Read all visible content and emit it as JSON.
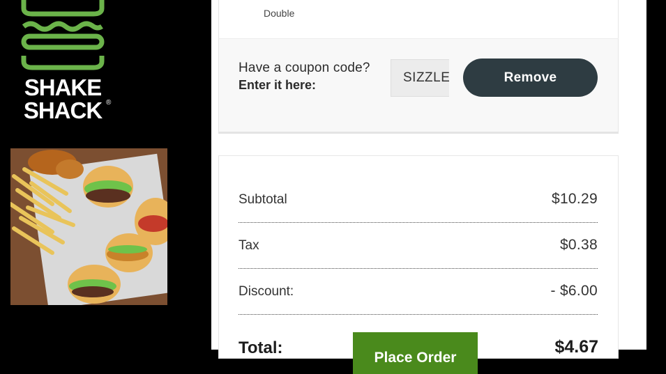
{
  "brand": {
    "name": "SHAKE SHACK"
  },
  "order_item": {
    "variant": "Double"
  },
  "coupon": {
    "question": "Have a coupon code?",
    "instruction": "Enter it here:",
    "code_value": "SIZZLE",
    "remove_label": "Remove"
  },
  "totals": {
    "subtotal_label": "Subtotal",
    "subtotal_value": "$10.29",
    "tax_label": "Tax",
    "tax_value": "$0.38",
    "discount_label": "Discount:",
    "discount_value": "- $6.00",
    "total_label": "Total:",
    "total_value": "$4.67",
    "place_order_label": "Place Order"
  },
  "colors": {
    "logo_green": "#6bb34a",
    "remove_button": "#2e3c42",
    "place_order": "#4a8a1c"
  }
}
